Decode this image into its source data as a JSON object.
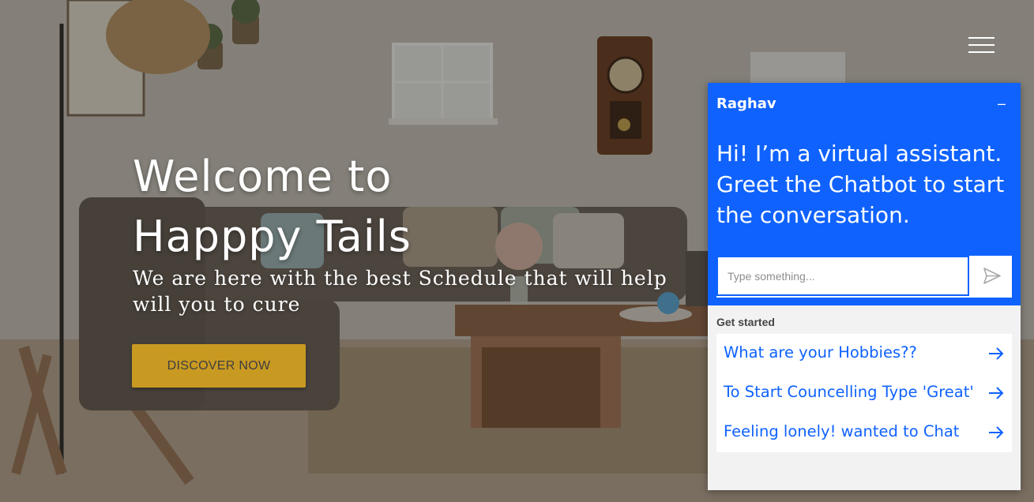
{
  "hero": {
    "title_line1": "Welcome to",
    "title_line2": "Happpy Tails",
    "subtitle": "We are here with the best Schedule that will help will you to cure",
    "cta_label": "DISCOVER NOW"
  },
  "nav": {
    "menu_icon": "hamburger-menu-icon"
  },
  "chat": {
    "assistant_name": "Raghav",
    "minimize_label": "–",
    "greeting": "Hi! I’m a virtual assistant. Greet the Chatbot to start the conversation.",
    "input_placeholder": "Type something...",
    "get_started_label": "Get started",
    "suggestions": [
      {
        "label": "What are your Hobbies??"
      },
      {
        "label": "To Start Councelling Type 'Great'"
      },
      {
        "label": "Feeling lonely! wanted to Chat"
      }
    ],
    "send_icon": "send-icon",
    "arrow_icon": "arrow-right-icon"
  },
  "colors": {
    "chat_blue": "#0f62fe",
    "cta_gold": "#c99a22",
    "panel_gray": "#f2f2f2"
  }
}
